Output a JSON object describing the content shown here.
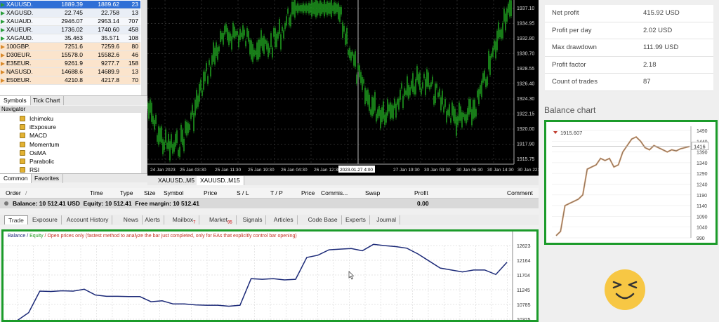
{
  "market_watch": {
    "rows": [
      {
        "symbol": "XAUUSD.",
        "bid": "1889.39",
        "ask": "1889.62",
        "spread": "23",
        "selected": true
      },
      {
        "symbol": "XAGUSD.",
        "bid": "22.745",
        "ask": "22.758",
        "spread": "13"
      },
      {
        "symbol": "XAUAUD.",
        "bid": "2946.07",
        "ask": "2953.14",
        "spread": "707"
      },
      {
        "symbol": "XAUEUR.",
        "bid": "1736.02",
        "ask": "1740.60",
        "spread": "458"
      },
      {
        "symbol": "XAGAUD.",
        "bid": "35.463",
        "ask": "35.571",
        "spread": "108"
      },
      {
        "symbol": "100GBP.",
        "bid": "7251.6",
        "ask": "7259.6",
        "spread": "80"
      },
      {
        "symbol": "D30EUR.",
        "bid": "15578.0",
        "ask": "15582.6",
        "spread": "46"
      },
      {
        "symbol": "E35EUR.",
        "bid": "9261.9",
        "ask": "9277.7",
        "spread": "158"
      },
      {
        "symbol": "NASUSD.",
        "bid": "14688.6",
        "ask": "14689.9",
        "spread": "13"
      },
      {
        "symbol": "E50EUR.",
        "bid": "4210.8",
        "ask": "4217.8",
        "spread": "70"
      }
    ],
    "tabs": [
      "Symbols",
      "Tick Chart"
    ]
  },
  "navigator": {
    "title": "Navigator",
    "items": [
      "Ichimoku",
      "iExposure",
      "MACD",
      "Momentum",
      "OsMA",
      "Parabolic",
      "RSI"
    ],
    "tabs": [
      "Common",
      "Favorites"
    ]
  },
  "chart": {
    "price_labels": [
      "1937.10",
      "1934.95",
      "1932.80",
      "1930.70",
      "1928.55",
      "1926.40",
      "1924.30",
      "1922.15",
      "1920.00",
      "1917.90",
      "1915.75"
    ],
    "time_labels": [
      "24 Jan 2023",
      "25 Jan 03:30",
      "25 Jan 11:30",
      "25 Jan 19:30",
      "26 Jan 04:30",
      "26 Jan 12:30",
      "26 Jan 20:30",
      "2023.01.27 4:00",
      "27 Jan 19:30",
      "30 Jan 03:30",
      "30 Jan 06:30",
      "30 Jan 14:30",
      "30 Jan 22:30"
    ],
    "tabs": [
      "XAUUSD.,M5",
      "XAUUSD.,M15"
    ]
  },
  "toolbox": {
    "columns": [
      "Order",
      "/",
      "Time",
      "Type",
      "Size",
      "Symbol",
      "Price",
      "S / L",
      "T / P",
      "Price",
      "Commis...",
      "Swap",
      "Profit",
      "Comment"
    ],
    "balance_line": "Balance: 10 512.41 USD  Equity: 10 512.41  Free margin: 10 512.41",
    "balance_profit": "0.00",
    "tabs": [
      {
        "label": "Trade",
        "badge": ""
      },
      {
        "label": "Exposure",
        "badge": ""
      },
      {
        "label": "Account History",
        "badge": ""
      },
      {
        "label": "News",
        "badge": ""
      },
      {
        "label": "Alerts",
        "badge": ""
      },
      {
        "label": "Mailbox",
        "badge": "7"
      },
      {
        "label": "Market",
        "badge": "95"
      },
      {
        "label": "Signals",
        "badge": ""
      },
      {
        "label": "Articles",
        "badge": ""
      },
      {
        "label": "Code Base",
        "badge": ""
      },
      {
        "label": "Experts",
        "badge": ""
      },
      {
        "label": "Journal",
        "badge": ""
      }
    ]
  },
  "report": {
    "legend_balance": "Balance",
    "legend_sep1": " / ",
    "legend_equity": "Equity",
    "legend_rest": " / Open prices only (fastest method to analyze the bar just completed, only for EAs that explicitly control bar opening)",
    "y_labels": [
      "12623",
      "12164",
      "11704",
      "11245",
      "10785",
      "10325"
    ],
    "balance_series": [
      10290,
      10530,
      11200,
      11190,
      11210,
      11200,
      11260,
      11080,
      11040,
      11040,
      11030,
      11030,
      10870,
      10900,
      10800,
      10800,
      10770,
      10760,
      10760,
      10730,
      10760,
      11590,
      11570,
      11590,
      11550,
      11570,
      12250,
      12320,
      12490,
      12510,
      12530,
      12460,
      12660,
      12620,
      12590,
      12540,
      12360,
      12140,
      11920,
      11860,
      11800,
      11860,
      11860,
      11720,
      12100
    ]
  },
  "stats": [
    {
      "label": "Net profit",
      "value": "415.92 USD"
    },
    {
      "label": "Profit per day",
      "value": "2.02 USD"
    },
    {
      "label": "Max drawdown",
      "value": "111.99 USD"
    },
    {
      "label": "Profit factor",
      "value": "2.18"
    },
    {
      "label": "Count of trades",
      "value": "87"
    }
  ],
  "balance_chart": {
    "title": "Balance chart",
    "marker_label": "1915.607",
    "current_label": "1416",
    "y_labels": [
      "1490",
      "1440",
      "1390",
      "1340",
      "1290",
      "1240",
      "1190",
      "1140",
      "1090",
      "1040",
      "990"
    ],
    "series": [
      1000,
      1020,
      1140,
      1150,
      1160,
      1170,
      1190,
      1310,
      1320,
      1330,
      1360,
      1350,
      1360,
      1320,
      1330,
      1390,
      1420,
      1450,
      1460,
      1440,
      1410,
      1400,
      1420,
      1410,
      1400,
      1390,
      1400,
      1395,
      1405,
      1410,
      1416
    ]
  },
  "colors": {
    "frame_green": "#1b9b2a",
    "candle_green": "#1f9a1f",
    "balance_line": "#1c2a78"
  },
  "icons": {
    "smiley": "grinning-face-emoji"
  }
}
